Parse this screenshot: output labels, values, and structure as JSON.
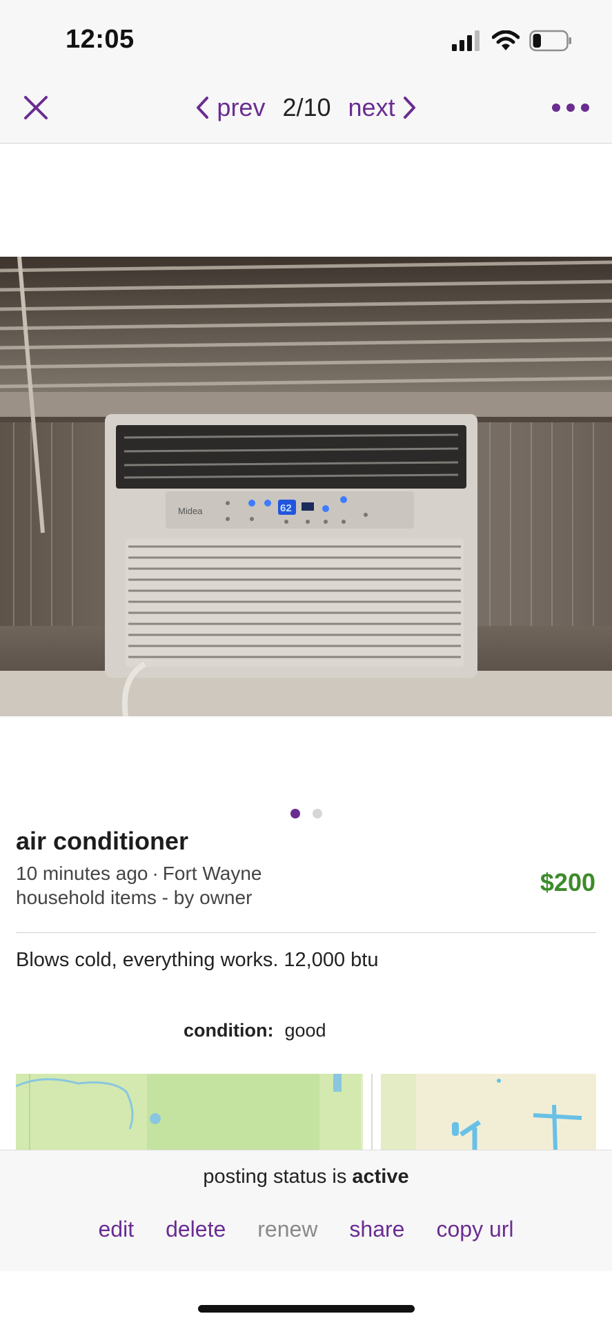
{
  "status_bar": {
    "time": "12:05",
    "battery_level": 0.25
  },
  "nav": {
    "prev_label": "prev",
    "counter": "2/10",
    "next_label": "next"
  },
  "gallery": {
    "image_count": 2,
    "active_index": 0
  },
  "posting": {
    "title": "air conditioner",
    "posted_ago": "10 minutes ago",
    "location": "Fort Wayne",
    "category": "household items - by owner",
    "price": "$200",
    "description": "Blows cold, everything works. 12,000 btu",
    "attribute_label": "condition:",
    "attribute_value": "good"
  },
  "photo": {
    "brand_text": "Midea",
    "display_text": "62"
  },
  "footer": {
    "status_prefix": "posting status is",
    "status_value": "active",
    "actions": [
      "edit",
      "delete",
      "renew",
      "share",
      "copy url"
    ]
  },
  "colors": {
    "accent": "#6a2c91",
    "price": "#3d8b2b",
    "muted": "#8a8a8a"
  }
}
